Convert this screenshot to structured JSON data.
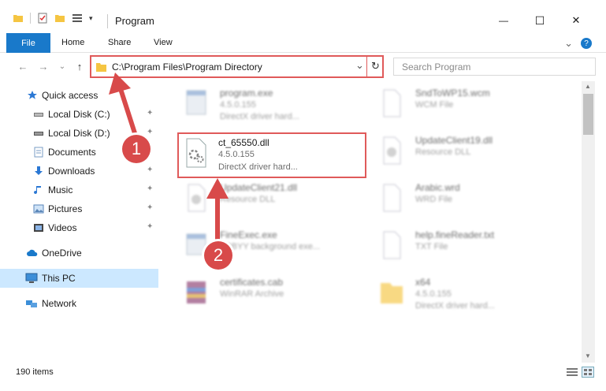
{
  "window": {
    "title": "Program",
    "minimize_glyph": "—",
    "maximize_glyph": "☐",
    "close_glyph": "✕"
  },
  "ribbon": {
    "tabs": [
      "File",
      "Home",
      "Share",
      "View"
    ],
    "help_glyph": "?",
    "expand_glyph": "⌄"
  },
  "nav": {
    "back_glyph": "←",
    "forward_glyph": "→",
    "recent_glyph": "⌄",
    "up_glyph": "↑",
    "address": "C:\\Program Files\\Program Directory",
    "address_dropdown_glyph": "⌄",
    "refresh_glyph": "↻",
    "search_placeholder": "Search Program"
  },
  "sidebar": {
    "items": [
      {
        "label": "Quick access",
        "icon": "star-icon",
        "pinned": false
      },
      {
        "label": "Local Disk (C:)",
        "icon": "drive-icon",
        "pinned": true
      },
      {
        "label": "Local Disk (D:)",
        "icon": "drive-icon",
        "pinned": true
      },
      {
        "label": "Documents",
        "icon": "documents-icon",
        "pinned": true
      },
      {
        "label": "Downloads",
        "icon": "download-icon",
        "pinned": true
      },
      {
        "label": "Music",
        "icon": "music-icon",
        "pinned": true
      },
      {
        "label": "Pictures",
        "icon": "pictures-icon",
        "pinned": true
      },
      {
        "label": "Videos",
        "icon": "videos-icon",
        "pinned": true
      },
      {
        "label": "OneDrive",
        "icon": "cloud-icon",
        "pinned": false
      },
      {
        "label": "This PC",
        "icon": "computer-icon",
        "pinned": false,
        "selected": true
      },
      {
        "label": "Network",
        "icon": "network-icon",
        "pinned": false
      }
    ],
    "pin_glyph": "📌"
  },
  "files": [
    {
      "name": "program.exe",
      "line2": "4.5.0.155",
      "line3": "DirectX driver hard..."
    },
    {
      "name": "SndToWP15.wcm",
      "line2": "WCM File",
      "line3": ""
    },
    {
      "name": "ct_65550.dll",
      "line2": "4.5.0.155",
      "line3": "DirectX driver hard..."
    },
    {
      "name": "UpdateClient19.dll",
      "line2": "Resource DLL",
      "line3": ""
    },
    {
      "name": "UpdateClient21.dll",
      "line2": "Resource DLL",
      "line3": ""
    },
    {
      "name": "Arabic.wrd",
      "line2": "WRD File",
      "line3": ""
    },
    {
      "name": "FineExec.exe",
      "line2": "ABBYY background exe...",
      "line3": ""
    },
    {
      "name": "help.fineReader.txt",
      "line2": "TXT File",
      "line3": ""
    },
    {
      "name": "certificates.cab",
      "line2": "WinRAR Archive",
      "line3": ""
    },
    {
      "name": "x64",
      "line2": "4.5.0.155",
      "line3": "DirectX driver hard..."
    }
  ],
  "status": {
    "item_count": "190 items"
  },
  "callouts": [
    "1",
    "2"
  ],
  "colors": {
    "accent": "#1979ca",
    "highlight": "#e05a5a",
    "selected": "#cce8ff"
  }
}
